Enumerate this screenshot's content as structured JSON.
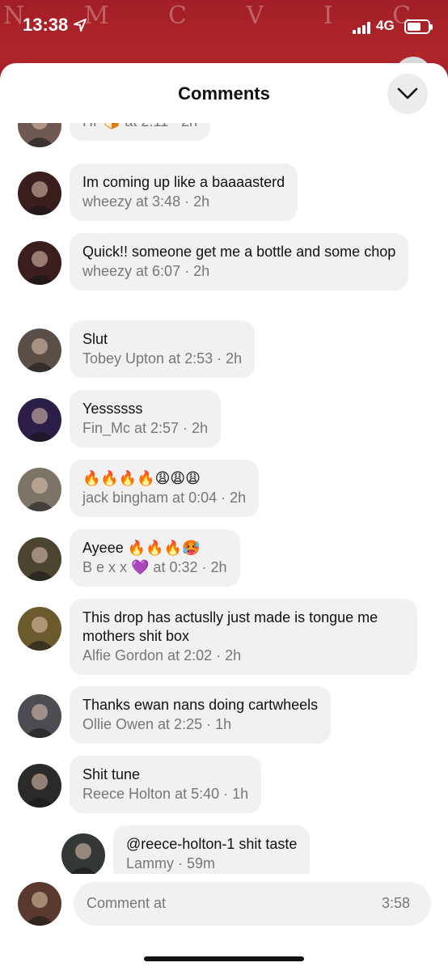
{
  "status_bar": {
    "time": "13:38",
    "network": "4G",
    "signal_bars": 4,
    "battery_level": 0.65,
    "background_lettering": "N M C V I C A R"
  },
  "sheet": {
    "title": "Comments",
    "collapse_icon": "chevron-down-icon"
  },
  "comments": [
    {
      "text": "",
      "author": "HP🍞",
      "time": "2:11",
      "age": "2h",
      "avatar_color": "#6e5a52"
    },
    {
      "text": "Im coming up like a baaaasterd",
      "author": "wheezy",
      "time": "3:48",
      "age": "2h",
      "avatar_color": "#3a1d1d"
    },
    {
      "text": "Quick!! someone get me a bottle and some chop",
      "author": "wheezy",
      "time": "6:07",
      "age": "2h",
      "avatar_color": "#3a1d1d"
    },
    {
      "text": "Slut",
      "author": "Tobey Upton",
      "time": "2:53",
      "age": "2h",
      "avatar_color": "#5b5048"
    },
    {
      "text": "Yessssss",
      "author": "Fin_Mc",
      "time": "2:57",
      "age": "2h",
      "avatar_color": "#2b1f4a"
    },
    {
      "text": "🔥🔥🔥🔥😩😩😩",
      "author": "jack bingham",
      "time": "0:04",
      "age": "2h",
      "avatar_color": "#7d7468"
    },
    {
      "text": "Ayeee 🔥🔥🔥🥵",
      "author": "B e x x 💜",
      "time": "0:32",
      "age": "2h",
      "avatar_color": "#4a4430"
    },
    {
      "text": "This drop has actuslly just made is tongue me mothers shit box",
      "author": "Alfie Gordon",
      "time": "2:02",
      "age": "2h",
      "avatar_color": "#6b5a2e"
    },
    {
      "text": "Thanks ewan nans doing cartwheels",
      "author": "Ollie Owen",
      "time": "2:25",
      "age": "1h",
      "avatar_color": "#4c4c52"
    },
    {
      "text": "Shit tune",
      "author": "Reece Holton",
      "time": "5:40",
      "age": "1h",
      "avatar_color": "#2a2a2a"
    },
    {
      "text": "@reece-holton-1 shit taste",
      "author": "Lammy ",
      "time": "",
      "age": "59m",
      "avatar_color": "#333836",
      "reply": true
    }
  ],
  "meta_connector": "at",
  "meta_separator": "·",
  "input": {
    "placeholder": "Comment at",
    "timestamp": "3:58",
    "avatar_color": "#5a3a2e"
  }
}
